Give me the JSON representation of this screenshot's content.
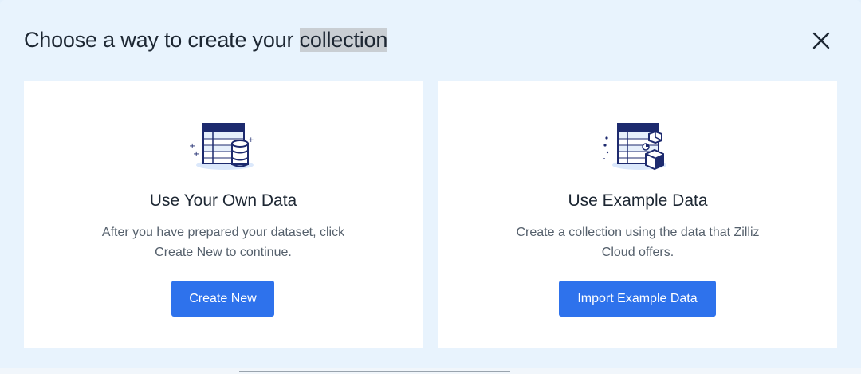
{
  "dialog": {
    "title_prefix": "Choose a way to create your ",
    "title_highlight": "collection",
    "close_icon": "close-icon"
  },
  "options": [
    {
      "icon": "table-database-icon",
      "title": "Use Your Own Data",
      "description": "After you have prepared your dataset, click Create New to continue.",
      "button_label": "Create New"
    },
    {
      "icon": "table-cube-icon",
      "title": "Use Example Data",
      "description": "Create a collection using the data that Zilliz Cloud offers.",
      "button_label": "Import Example Data"
    }
  ],
  "colors": {
    "primary_button": "#2e72ec",
    "background": "#e8f3fd",
    "card": "#ffffff",
    "illustration_navy": "#1d2a6e"
  }
}
